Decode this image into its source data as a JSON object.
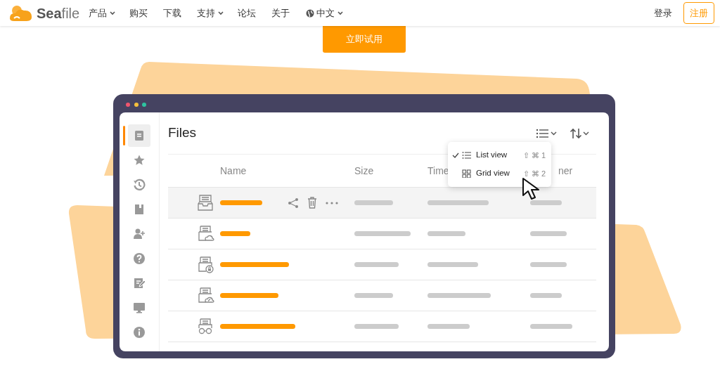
{
  "nav": {
    "brand": "**Sea**file",
    "items": [
      {
        "label": "产品",
        "dropdown": true
      },
      {
        "label": "购买",
        "dropdown": false
      },
      {
        "label": "下载",
        "dropdown": false
      },
      {
        "label": "支持",
        "dropdown": true
      },
      {
        "label": "论坛",
        "dropdown": false
      },
      {
        "label": "关于",
        "dropdown": false
      }
    ],
    "language": "中文",
    "login": "登录",
    "register": "注册"
  },
  "cta": "立即试用",
  "app": {
    "sidebar": [
      {
        "kind": "files",
        "selected": true
      },
      {
        "kind": "star",
        "selected": false
      },
      {
        "kind": "history",
        "selected": false
      },
      {
        "kind": "book",
        "selected": false
      },
      {
        "kind": "add-user",
        "selected": false
      },
      {
        "kind": "help",
        "selected": false
      },
      {
        "kind": "edit",
        "selected": false
      },
      {
        "kind": "monitor",
        "selected": false
      },
      {
        "kind": "info",
        "selected": false
      }
    ],
    "title": "Files",
    "view_menu": [
      {
        "kind": "list",
        "label": "List view",
        "shortcut": "⇧ ⌘ 1",
        "checked": true
      },
      {
        "kind": "grid",
        "label": "Grid view",
        "shortcut": "⇧ ⌘ 2",
        "checked": false
      }
    ],
    "table": {
      "columns": [
        "Name",
        "Size",
        "Time",
        "ner"
      ],
      "rows": [
        {
          "kind": "inbox",
          "selected": true
        },
        {
          "kind": "cloud",
          "selected": false
        },
        {
          "kind": "lock",
          "selected": false
        },
        {
          "kind": "cloud-edit",
          "selected": false
        },
        {
          "kind": "glasses",
          "selected": false
        }
      ]
    }
  }
}
